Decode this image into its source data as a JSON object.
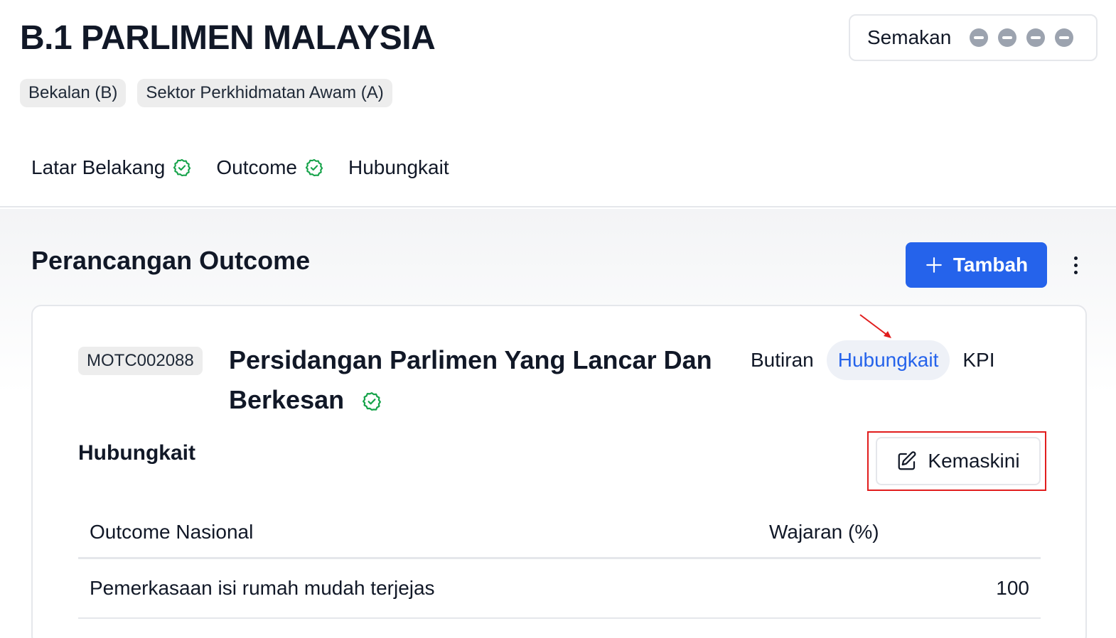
{
  "header": {
    "title": "B.1 PARLIMEN MALAYSIA",
    "review_label": "Semakan",
    "chips": [
      "Bekalan (B)",
      "Sektor Perkhidmatan Awam (A)"
    ],
    "tabs": [
      {
        "label": "Latar Belakang",
        "completed": true
      },
      {
        "label": "Outcome",
        "completed": true
      },
      {
        "label": "Hubungkait",
        "completed": false
      }
    ]
  },
  "section": {
    "title": "Perancangan Outcome",
    "add_button_label": "Tambah"
  },
  "card": {
    "code": "MOTC002088",
    "title": "Persidangan Parlimen Yang Lancar Dan Berkesan",
    "completed": true,
    "subtabs": [
      {
        "label": "Butiran",
        "active": false
      },
      {
        "label": "Hubungkait",
        "active": true
      },
      {
        "label": "KPI",
        "active": false
      }
    ],
    "relation_heading": "Hubungkait",
    "edit_button_label": "Kemaskini",
    "table": {
      "columns": [
        "Outcome Nasional",
        "Wajaran (%)"
      ],
      "rows": [
        {
          "outcome": "Pemerkasaan isi rumah mudah terjejas",
          "weight": "100"
        }
      ]
    }
  },
  "colors": {
    "primary": "#2563eb",
    "success": "#16a34a",
    "highlight": "#e11d1d",
    "status_dot": "#9ca3af"
  }
}
